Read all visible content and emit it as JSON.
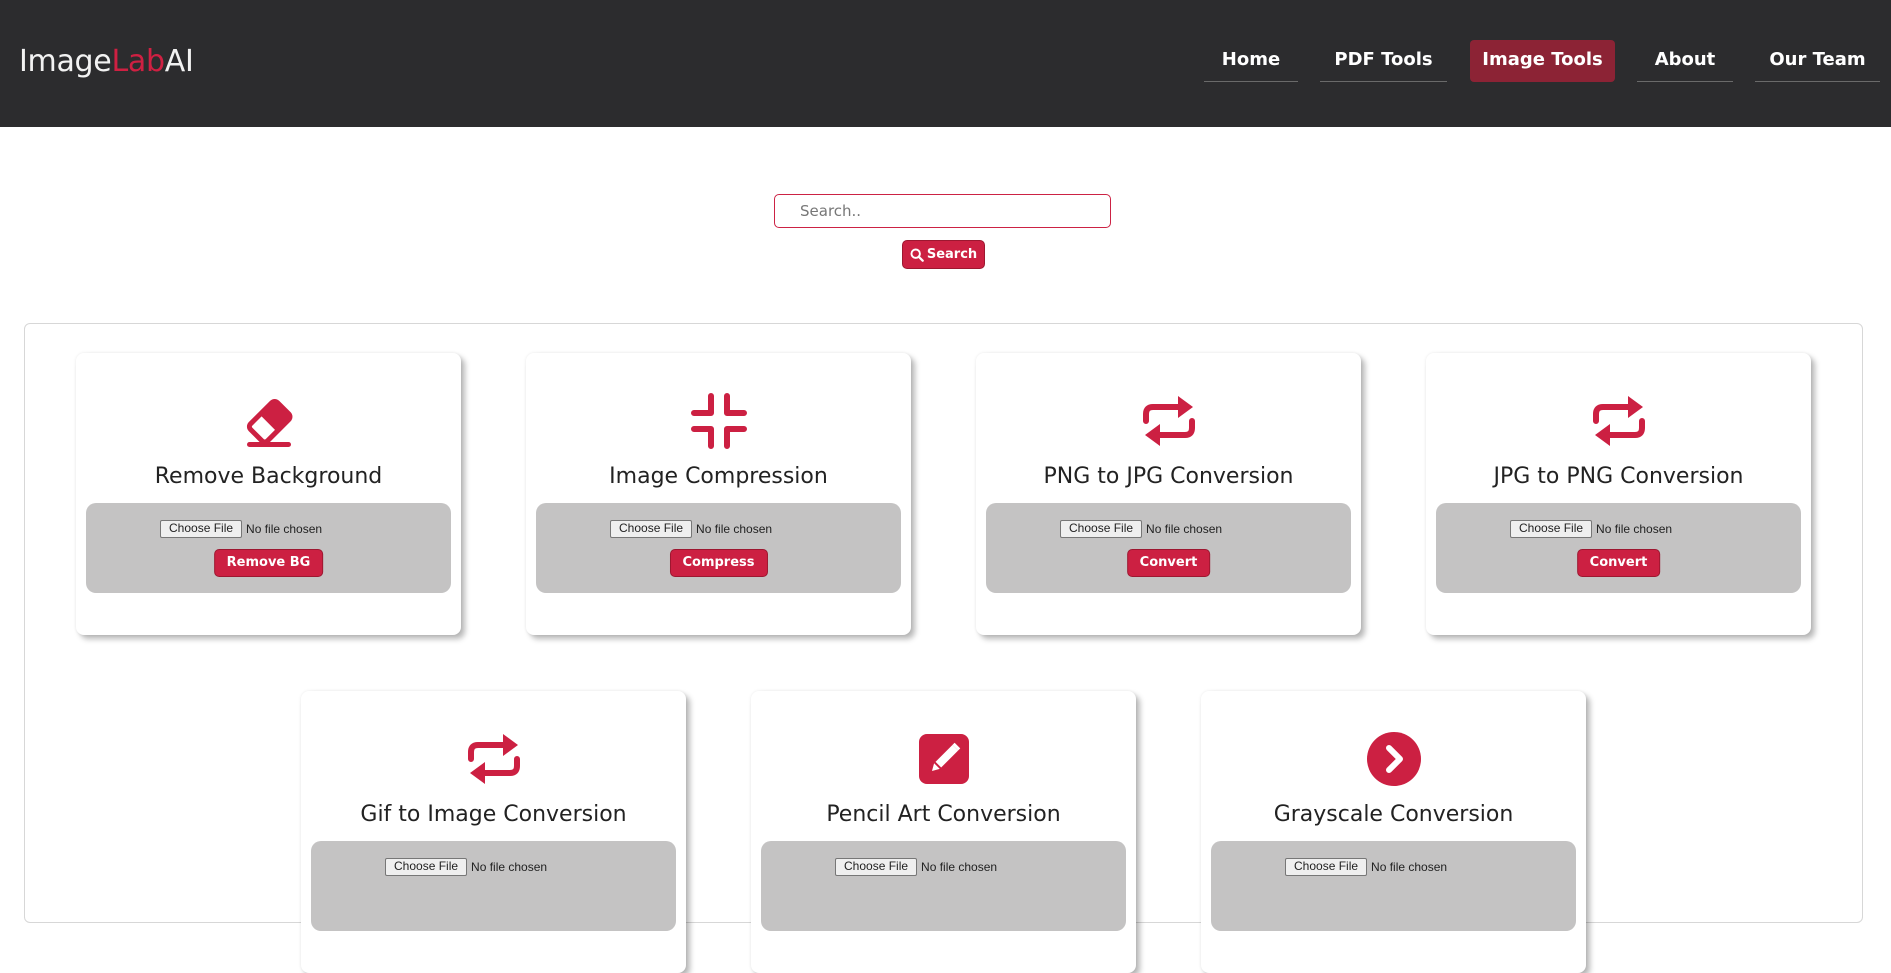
{
  "brand": {
    "part1": "Image",
    "part2": "Lab",
    "part3": "AI"
  },
  "nav": {
    "items": [
      {
        "label": "Home"
      },
      {
        "label": "PDF Tools"
      },
      {
        "label": "Image Tools",
        "active": true
      },
      {
        "label": "About"
      },
      {
        "label": "Our Team"
      }
    ]
  },
  "search": {
    "placeholder": "Search..",
    "button_label": "Search"
  },
  "colors": {
    "accent": "#cc2042",
    "navbar": "#2c2c2e",
    "upload_bg": "#c4c3c3"
  },
  "file_input": {
    "button_label": "Choose File",
    "status": "No file chosen"
  },
  "cards": [
    {
      "title": "Remove Background",
      "icon": "eraser-icon",
      "action": "Remove BG"
    },
    {
      "title": "Image Compression",
      "icon": "compress-icon",
      "action": "Compress"
    },
    {
      "title": "PNG to JPG Conversion",
      "icon": "repeat-icon",
      "action": "Convert"
    },
    {
      "title": "JPG to PNG Conversion",
      "icon": "repeat-icon",
      "action": "Convert"
    },
    {
      "title": "Gif to Image Conversion",
      "icon": "repeat-icon"
    },
    {
      "title": "Pencil Art Conversion",
      "icon": "pencil-square-icon"
    },
    {
      "title": "Grayscale Conversion",
      "icon": "chevron-circle-right-icon"
    }
  ]
}
